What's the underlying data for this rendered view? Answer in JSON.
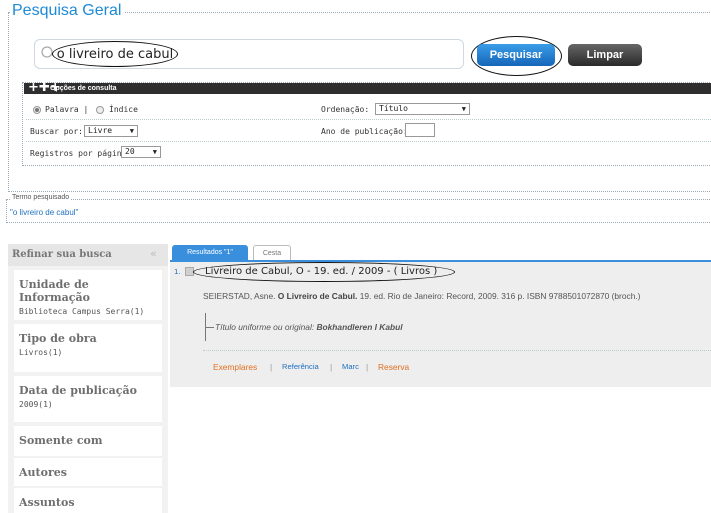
{
  "header": {
    "title": "Pesquisa Geral"
  },
  "search": {
    "value": "o livreiro de cabul",
    "search_label": "Pesquisar",
    "clear_label": "Limpar"
  },
  "options": {
    "title": "Opções de consulta",
    "radio_word": "Palavra |",
    "radio_index": "Índice",
    "sort_label": "Ordenação:",
    "sort_value": "Título",
    "search_by_label": "Buscar por:",
    "search_by_value": "Livre",
    "year_label": "Ano de publicação:",
    "per_page_label": "Registros por página:",
    "per_page_value": "20"
  },
  "term": {
    "title": "Termo pesquisado",
    "value": "\"o livreiro de cabul\""
  },
  "sidebar": {
    "title": "Refinar sua busca",
    "facets": [
      {
        "title": "Unidade de Informação",
        "value": "Biblioteca Campus Serra(1)"
      },
      {
        "title": "Tipo de obra",
        "value": "Livros(1)"
      },
      {
        "title": "Data de publicação",
        "value": "2009(1)"
      },
      {
        "title": "Somente com",
        "value": ""
      },
      {
        "title": "Autores",
        "value": ""
      },
      {
        "title": "Assuntos",
        "value": ""
      }
    ]
  },
  "tabs": {
    "results": "Resultados \"1\"",
    "basket": "Cesta"
  },
  "result": {
    "number": "1.",
    "title": "Livreiro de Cabul, O - 19. ed. / 2009 - ( Livros )",
    "author": "SEIERSTAD, Asne.",
    "work_title": "O Livreiro de Cabul.",
    "details": "19. ed. Rio de Janeiro: Record, 2009. 316 p. ISBN 9788501072870 (broch.)",
    "uniform_label": "Título uniforme ou original:",
    "uniform_value": "Bokhandleren I Kabul",
    "links": [
      "Exemplares",
      "Referência",
      "Marc",
      "Reserva"
    ]
  },
  "colors": {
    "accent": "#1e8ad6",
    "link_orange": "#e07020",
    "link_blue": "#1e6fc0"
  }
}
